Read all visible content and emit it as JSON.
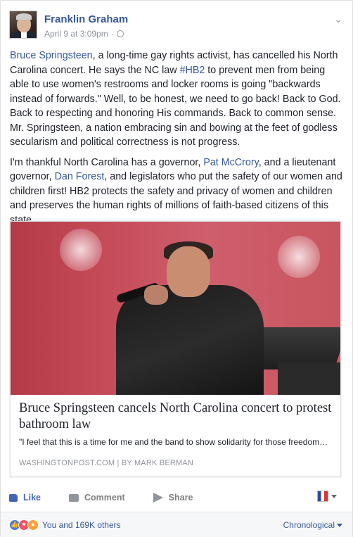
{
  "post": {
    "author": "Franklin Graham",
    "timestamp": "April 9 at 3:09pm",
    "separator": "·",
    "icons": {
      "privacy": "globe-icon",
      "menu": "chevron-down-icon"
    },
    "paragraph1": {
      "link1": "Bruce Springsteen",
      "text1": ", a long-time gay rights activist, has cancelled his North Carolina concert. He says the NC law ",
      "hashtag": "#HB2",
      "text2": " to prevent men from being able to use women's restrooms and locker rooms is going \"backwards instead of forwards.\" Well, to be honest, we need to go back! Back to God. Back to respecting and honoring His commands. Back to common sense. Mr. Springsteen, a nation embracing sin and bowing at the feet of godless secularism and political correctness is not progress."
    },
    "paragraph2": {
      "text1": "I'm thankful North Carolina has a governor, ",
      "link1": "Pat McCrory",
      "text2": ", and a lieutenant governor, ",
      "link2": "Dan Forest",
      "text3": ", and legislators who put the safety of our women and children first! HB2 protects the safety and privacy of women and children and preserves the human rights of millions of faith-based citizens of this state."
    }
  },
  "attachment": {
    "title": "Bruce Springsteen cancels North Carolina concert to protest bathroom law",
    "description": "\"I feel that this is a time for me and the band to show solidarity for those freedom…",
    "source": "WASHINGTONPOST.COM",
    "source_sep": "|",
    "byline": "BY MARK BERMAN"
  },
  "actions": {
    "like": "Like",
    "comment": "Comment",
    "share": "Share",
    "colors": {
      "active": "#4267b2",
      "inactive": "#7f7f7f"
    }
  },
  "footer": {
    "reactions_text": "You and 169K others",
    "sort_label": "Chronological",
    "reaction_icons": [
      "like-reaction-icon",
      "love-reaction-icon",
      "angry-reaction-icon"
    ]
  },
  "colors": {
    "link": "#365899",
    "meta": "#90949c",
    "text": "#1d2129",
    "footer_bg": "#f6f7f9"
  }
}
